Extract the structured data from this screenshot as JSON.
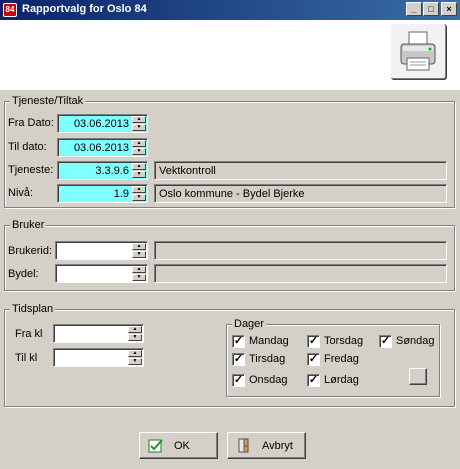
{
  "window": {
    "title": "Rapportvalg for Oslo 84",
    "app_icon_text": "84",
    "controls": {
      "minimize": "_",
      "maximize": "□",
      "close": "×"
    }
  },
  "toolbar": {
    "print_icon": "printer-icon"
  },
  "tjeneste_group": {
    "legend": "Tjeneste/Tiltak",
    "fra_dato": {
      "label": "Fra Dato:",
      "value": "03.06.2013"
    },
    "til_dato": {
      "label": "Til dato:",
      "value": "03.06.2013"
    },
    "tjeneste": {
      "label": "Tjeneste:",
      "value": "3.3.9.6",
      "description": "Vektkontroll"
    },
    "niva": {
      "label": "Nivå:",
      "value": "1.9",
      "description": "Oslo kommune - Bydel Bjerke"
    }
  },
  "bruker_group": {
    "legend": "Bruker",
    "brukerid": {
      "label": "Brukerid:",
      "value": "",
      "description": ""
    },
    "bydel": {
      "label": "Bydel:",
      "value": "",
      "description": ""
    }
  },
  "tidsplan_group": {
    "legend": "Tidsplan",
    "fra_kl": {
      "label": "Fra kl",
      "value": ""
    },
    "til_kl": {
      "label": "Til kl",
      "value": ""
    },
    "dager": {
      "legend": "Dager",
      "days": [
        {
          "label": "Mandag",
          "checked": true
        },
        {
          "label": "Tirsdag",
          "checked": true
        },
        {
          "label": "Onsdag",
          "checked": true
        },
        {
          "label": "Torsdag",
          "checked": true
        },
        {
          "label": "Fredag",
          "checked": true
        },
        {
          "label": "Lørdag",
          "checked": true
        },
        {
          "label": "Søndag",
          "checked": true
        }
      ]
    }
  },
  "buttons": {
    "ok": "OK",
    "cancel": "Avbryt"
  }
}
